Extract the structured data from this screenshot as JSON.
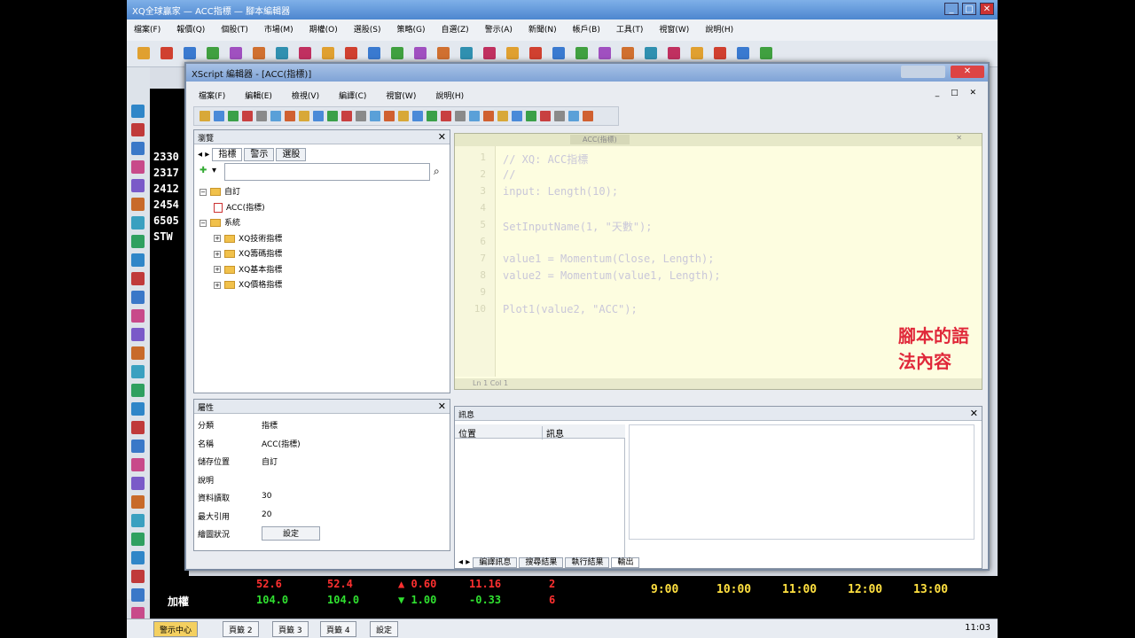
{
  "app": {
    "title": "XQ全球贏家 — ACC指標 — 腳本編輯器",
    "menu": [
      "檔案(F)",
      "報價(Q)",
      "個股(T)",
      "市場(M)",
      "期權(O)",
      "選股(S)",
      "策略(G)",
      "自選(Z)",
      "警示(A)",
      "新聞(N)",
      "帳戶(B)",
      "工具(T)",
      "視窗(W)",
      "說明(H)"
    ],
    "quote_codes": [
      "2330",
      "2317",
      "2412",
      "2454",
      "6505",
      "STW"
    ],
    "bottom": {
      "row1": [
        "52.6",
        "52.4",
        "▲ 0.60",
        "11.16",
        "2"
      ],
      "row2_label": "加權",
      "row2": [
        "104.0",
        "104.0",
        "▼ 1.00",
        "-0.33",
        "6"
      ],
      "times": [
        "9:00",
        "10:00",
        "11:00",
        "12:00",
        "13:00"
      ]
    },
    "tabs": [
      "警示中心",
      "頁籤 2",
      "頁籤 3",
      "頁籤 4",
      "設定"
    ],
    "clock": "11:03"
  },
  "xs": {
    "title": "XScript 編輯器 - [ACC(指標)]",
    "close": "✕",
    "menu": [
      "檔案(F)",
      "編輯(E)",
      "檢視(V)",
      "編譯(C)",
      "視窗(W)",
      "說明(H)"
    ],
    "ctl": "_ □ ✕",
    "nav": {
      "title": "瀏覽",
      "tabs": [
        "指標",
        "警示",
        "選股"
      ],
      "tree": [
        {
          "label": "自訂",
          "type": "folder",
          "level": 0
        },
        {
          "label": "ACC(指標)",
          "type": "file",
          "level": 1
        },
        {
          "label": "系統",
          "type": "folder",
          "level": 0
        },
        {
          "label": "XQ技術指標",
          "type": "folder",
          "level": 1
        },
        {
          "label": "XQ籌碼指標",
          "type": "folder",
          "level": 1
        },
        {
          "label": "XQ基本指標",
          "type": "folder",
          "level": 1
        },
        {
          "label": "XQ價格指標",
          "type": "folder",
          "level": 1
        }
      ]
    },
    "props": {
      "title": "屬性",
      "rows": [
        {
          "k": "分類",
          "v": "指標"
        },
        {
          "k": "名稱",
          "v": "ACC(指標)"
        },
        {
          "k": "儲存位置",
          "v": "自訂"
        },
        {
          "k": "說明",
          "v": ""
        },
        {
          "k": "資料讀取",
          "v": "30"
        },
        {
          "k": "最大引用",
          "v": "20"
        },
        {
          "k": "繪圖狀況",
          "v": "設定"
        }
      ]
    },
    "editor": {
      "tabs": "ACC(指標)",
      "lines": [
        "// XQ: ACC指標",
        "//",
        "input: Length(10);",
        "",
        "SetInputName(1, \"天數\");",
        "",
        "value1 = Momentum(Close, Length);",
        "value2 = Momentum(value1, Length);",
        "",
        "Plot1(value2, \"ACC\");"
      ],
      "overlay": "腳本的語法內容",
      "status": "Ln 1  Col 1"
    },
    "output": {
      "title": "訊息",
      "cols": [
        "位置",
        "訊息"
      ],
      "tabs": [
        "編譯訊息",
        "搜尋結果",
        "執行結果",
        "輸出"
      ]
    }
  }
}
